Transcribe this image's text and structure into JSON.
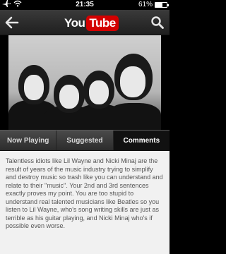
{
  "status": {
    "time": "21:35",
    "battery_percent": "61%",
    "battery_level": 0.61,
    "icons": [
      "airplane-icon",
      "wifi-icon",
      "battery-icon"
    ]
  },
  "header": {
    "logo_you": "You",
    "logo_tube": "Tube",
    "back_icon": "back-arrow-icon",
    "search_icon": "search-icon",
    "brand_color": "#d40000"
  },
  "tabs": [
    {
      "label": "Now Playing",
      "active": false
    },
    {
      "label": "Suggested",
      "active": false
    },
    {
      "label": "Comments",
      "active": true
    }
  ],
  "comment": {
    "text": "Talentless idiots like Lil Wayne and Nicki Minaj are the result of years of the music industry trying to simplify and destroy music so trash like you can understand and relate to their ''music''. Your 2nd and 3rd sentences exactly proves my point. You are too stupid to understand real talented musicians like Beatles so you listen to Lil Wayne, who's song writing skills are just as terrible as his guitar playing, and Nicki Minaj who's if possible even worse."
  }
}
